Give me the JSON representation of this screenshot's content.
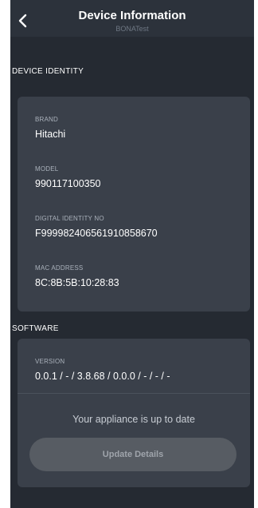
{
  "header": {
    "title": "Device Information",
    "subtitle": "BONATest"
  },
  "device_identity": {
    "section_title": "DEVICE IDENTITY",
    "fields": [
      {
        "label": "BRAND",
        "value": "Hitachi"
      },
      {
        "label": "MODEL",
        "value": "990117100350"
      },
      {
        "label": "DIGITAL IDENTITY NO",
        "value": "F999982406561910858670"
      },
      {
        "label": "MAC ADDRESS",
        "value": "8C:8B:5B:10:28:83"
      }
    ]
  },
  "software": {
    "section_title": "SOFTWARE",
    "version_label": "VERSION",
    "version_value": "0.0.1 / - / 3.8.68 / 0.0.0 / - / - / -",
    "status_text": "Your appliance is up to date",
    "update_button_label": "Update Details"
  },
  "icons": {
    "back": "chevron-left-icon"
  },
  "colors": {
    "background": "#252a32",
    "header": "#2c323b",
    "card": "#3a404a",
    "button": "#575c63"
  }
}
